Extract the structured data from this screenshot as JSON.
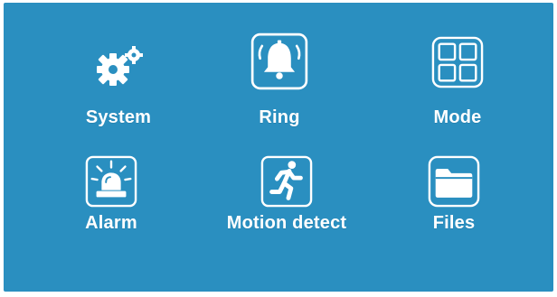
{
  "background_color": "#2a8fc0",
  "icon_color": "#ffffff",
  "menu": {
    "items": [
      {
        "label": "System",
        "icon": "gears-icon"
      },
      {
        "label": "Ring",
        "icon": "bell-icon"
      },
      {
        "label": "Mode",
        "icon": "grid-icon"
      },
      {
        "label": "Alarm",
        "icon": "siren-icon"
      },
      {
        "label": "Motion detect",
        "icon": "running-man-icon"
      },
      {
        "label": "Files",
        "icon": "folder-icon"
      }
    ]
  }
}
